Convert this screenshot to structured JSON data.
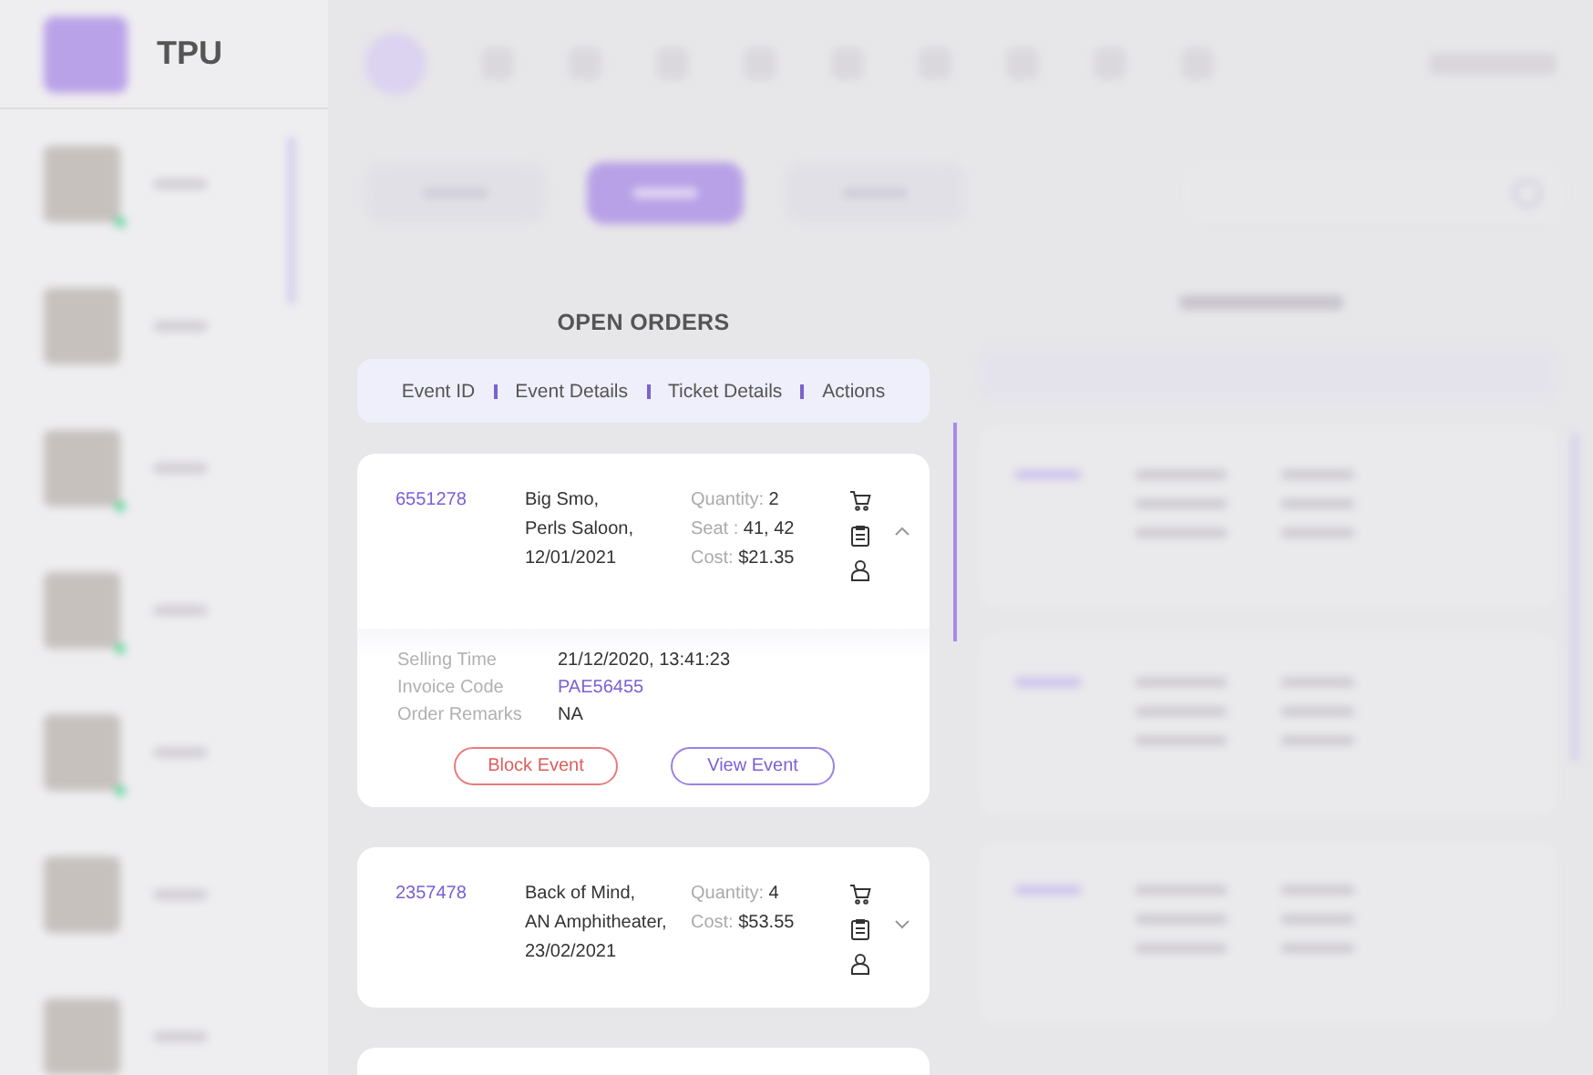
{
  "brand": {
    "name": "TPU"
  },
  "sidebar": {
    "items": [
      {
        "online": true
      },
      {
        "online": false
      },
      {
        "online": true
      },
      {
        "online": true
      },
      {
        "online": true
      },
      {
        "online": false
      },
      {
        "online": false
      }
    ]
  },
  "top_tabs": [
    {
      "selected": false
    },
    {
      "selected": true
    },
    {
      "selected": false
    }
  ],
  "open_orders": {
    "title": "OPEN ORDERS",
    "columns": [
      "Event ID",
      "Event Details",
      "Ticket Details",
      "Actions"
    ],
    "orders": [
      {
        "id": "6551278",
        "event": [
          "Big Smo,",
          "Perls Saloon,",
          "12/01/2021"
        ],
        "tickets": [
          {
            "label": "Quantity:",
            "value": "2"
          },
          {
            "label": "Seat :",
            "value": "41, 42"
          },
          {
            "label": "Cost:",
            "value": "$21.35"
          }
        ],
        "expanded": true,
        "details": [
          {
            "label": "Selling Time",
            "value": "21/12/2020, 13:41:23",
            "kind": "text"
          },
          {
            "label": "Invoice Code",
            "value": "PAE56455",
            "kind": "link"
          },
          {
            "label": "Order Remarks",
            "value": "NA",
            "kind": "text"
          }
        ],
        "actions": [
          {
            "label": "Block Event",
            "kind": "danger"
          },
          {
            "label": "View Event",
            "kind": "primary"
          }
        ]
      },
      {
        "id": "2357478",
        "event": [
          "Back of Mind,",
          "AN Amphitheater,",
          "23/02/2021"
        ],
        "tickets": [
          {
            "label": "Quantity:",
            "value": "4"
          },
          {
            "label": "Cost:",
            "value": "$53.55"
          }
        ],
        "expanded": false
      }
    ]
  }
}
